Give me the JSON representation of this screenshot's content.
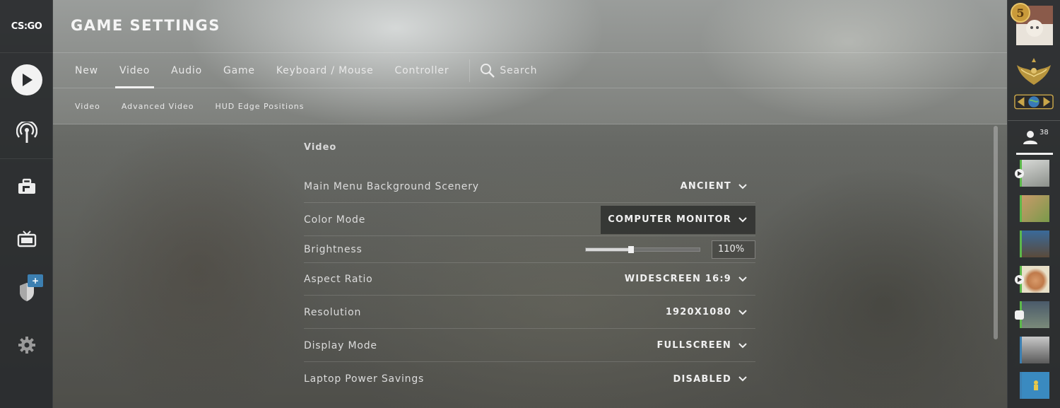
{
  "app": {
    "logo_text": "CS:GO",
    "title": "GAME SETTINGS"
  },
  "tabs": [
    {
      "label": "New"
    },
    {
      "label": "Video",
      "active": true
    },
    {
      "label": "Audio"
    },
    {
      "label": "Game"
    },
    {
      "label": "Keyboard / Mouse"
    },
    {
      "label": "Controller"
    }
  ],
  "search": {
    "label": "Search"
  },
  "subtabs": [
    {
      "label": "Video"
    },
    {
      "label": "Advanced Video"
    },
    {
      "label": "HUD Edge Positions"
    }
  ],
  "section": {
    "title": "Video"
  },
  "settings": [
    {
      "label": "Main Menu Background Scenery",
      "value": "ANCIENT"
    },
    {
      "label": "Color Mode",
      "value": "COMPUTER MONITOR"
    },
    {
      "label": "Brightness",
      "value": "110%",
      "slider_fraction": 0.4
    },
    {
      "label": "Aspect Ratio",
      "value": "WIDESCREEN 16:9"
    },
    {
      "label": "Resolution",
      "value": "1920X1080"
    },
    {
      "label": "Display Mode",
      "value": "FULLSCREEN"
    },
    {
      "label": "Laptop Power Savings",
      "value": "DISABLED"
    }
  ],
  "rank": {
    "level": "5"
  },
  "friends": {
    "count": "38"
  },
  "colors": {
    "accent_blue": "#3c7fb1",
    "online_green": "#5cb84a"
  }
}
